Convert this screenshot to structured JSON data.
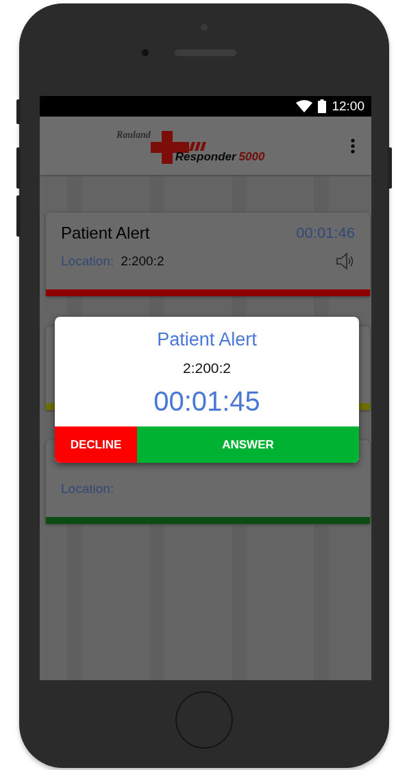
{
  "status_bar": {
    "time": "12:00"
  },
  "app_bar": {
    "logo": {
      "brand": "Rauland",
      "product": "Responder",
      "model": "5000"
    }
  },
  "alerts": [
    {
      "title": "Patient Alert",
      "elapsed": "00:01:46",
      "location_label": "Location:",
      "location": "2:200:2",
      "sound": true,
      "color": "#8c0000"
    },
    {
      "color": "#6f6f00"
    },
    {
      "location_label": "Location:",
      "color": "#0a4c14"
    }
  ],
  "dialog": {
    "title": "Patient Alert",
    "location": "2:200:2",
    "elapsed": "00:01:45",
    "buttons": [
      {
        "label": "DECLINE",
        "kind": "decline"
      },
      {
        "label": "ANSWER",
        "kind": "answer"
      }
    ]
  }
}
